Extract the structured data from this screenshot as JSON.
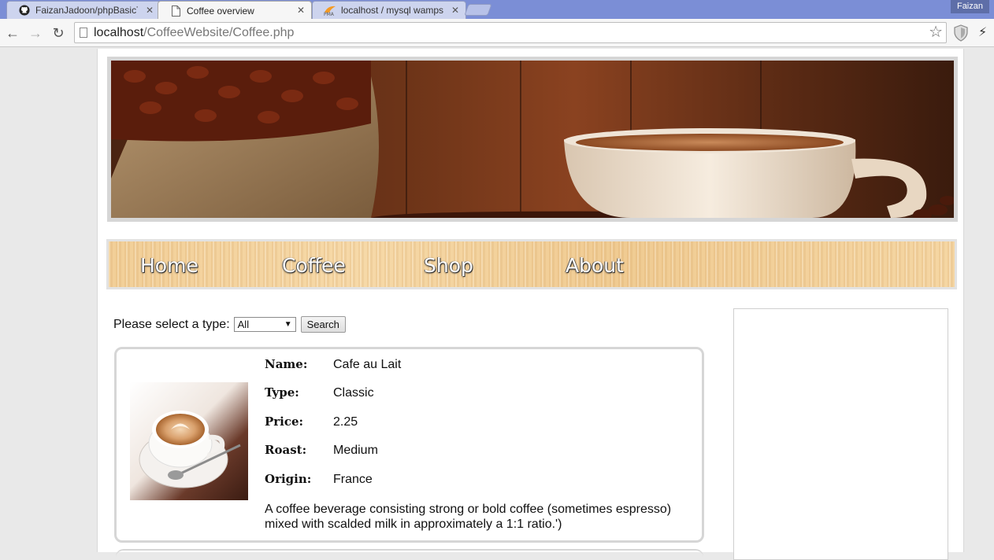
{
  "browser": {
    "tabs": [
      {
        "title": "FaizanJadoon/phpBasicTe",
        "icon": "github-icon",
        "active": false
      },
      {
        "title": "Coffee overview",
        "icon": "page-icon",
        "active": true
      },
      {
        "title": "localhost / mysql wampse",
        "icon": "phpmyadmin-icon",
        "active": false
      }
    ],
    "profile_name": "Faizan",
    "url_host": "localhost",
    "url_path": "/CoffeeWebsite/Coffee.php"
  },
  "nav": {
    "items": [
      "Home",
      "Coffee",
      "Shop",
      "About"
    ]
  },
  "filter": {
    "label": "Please select a type:",
    "selected": "All",
    "search_label": "Search"
  },
  "product": {
    "name_label": "Name:",
    "name": "Cafe au Lait",
    "type_label": "Type:",
    "type": "Classic",
    "price_label": "Price:",
    "price": "2.25",
    "roast_label": "Roast:",
    "roast": "Medium",
    "origin_label": "Origin:",
    "origin": "France",
    "description": "A coffee beverage consisting strong or bold coffee (sometimes espresso) mixed with scalded milk in approximately a 1:1 ratio.')"
  },
  "colors": {
    "tabstrip": "#7b8ed6",
    "nav_wood": "#f2cf98",
    "card_border": "#d6d6d6"
  }
}
